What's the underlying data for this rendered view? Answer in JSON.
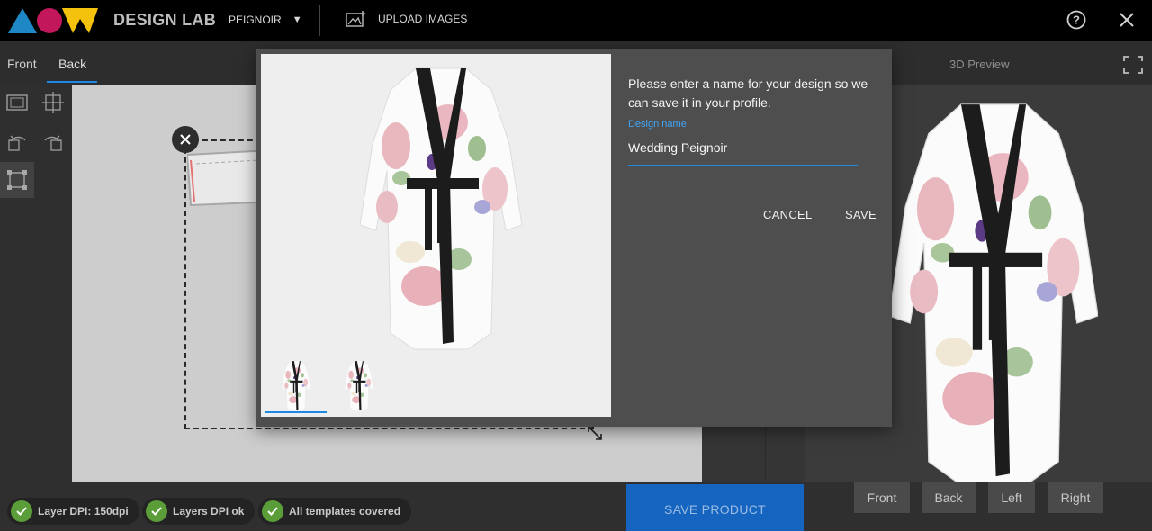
{
  "header": {
    "brand": "DESIGN LAB",
    "product": "PEIGNOIR",
    "upload_label": "UPLOAD IMAGES",
    "logo_colors": [
      "#1e88c7",
      "#c2185b",
      "#f4c20d"
    ]
  },
  "tabs": [
    {
      "label": "Front"
    },
    {
      "label": "Back",
      "active": true
    }
  ],
  "preview": {
    "title": "3D Preview",
    "views": [
      "Front",
      "Back",
      "Left",
      "Right"
    ]
  },
  "modal": {
    "message": "Please enter a name for your design so we can save it in your profile.",
    "field_label": "Design name",
    "field_value": "Wedding Peignoir",
    "cancel_label": "CANCEL",
    "save_label": "SAVE"
  },
  "status": [
    {
      "label": "Layer DPI: 150dpi"
    },
    {
      "label": "Layers DPI ok"
    },
    {
      "label": "All templates covered"
    }
  ],
  "save_product_label": "SAVE PRODUCT",
  "colors": {
    "accent": "#1e88e5",
    "ok": "#5b9d38",
    "primary_button": "#1565c0"
  },
  "icons": [
    "help-icon",
    "close-icon",
    "fullscreen-icon",
    "upload-image-icon",
    "check-icon"
  ]
}
